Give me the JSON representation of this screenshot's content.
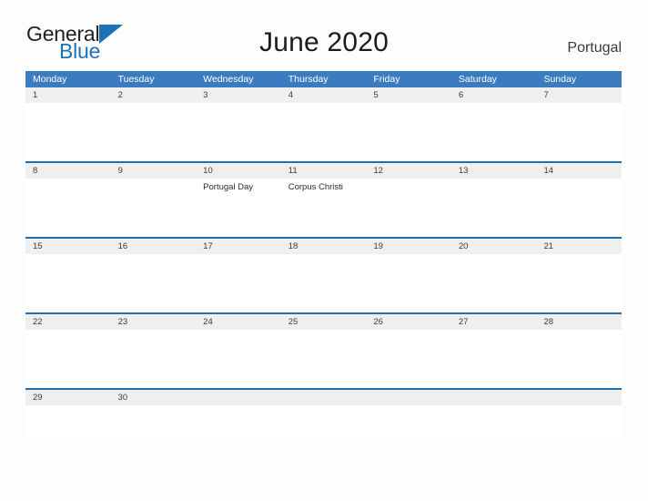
{
  "brand": {
    "name_part1": "General",
    "name_part2": "Blue",
    "mark": "triangle-icon",
    "accent_color": "#1c72b8"
  },
  "header": {
    "title": "June 2020",
    "country": "Portugal"
  },
  "colors": {
    "header_band": "#3b7cc0",
    "rule": "#1f6fb2",
    "date_stripe": "#efefef",
    "page_background": "#fdfdfd"
  },
  "weekdays": [
    "Monday",
    "Tuesday",
    "Wednesday",
    "Thursday",
    "Friday",
    "Saturday",
    "Sunday"
  ],
  "weeks": [
    {
      "dates": [
        "1",
        "2",
        "3",
        "4",
        "5",
        "6",
        "7"
      ],
      "events": [
        "",
        "",
        "",
        "",
        "",
        "",
        ""
      ]
    },
    {
      "dates": [
        "8",
        "9",
        "10",
        "11",
        "12",
        "13",
        "14"
      ],
      "events": [
        "",
        "",
        "Portugal Day",
        "Corpus Christi",
        "",
        "",
        ""
      ]
    },
    {
      "dates": [
        "15",
        "16",
        "17",
        "18",
        "19",
        "20",
        "21"
      ],
      "events": [
        "",
        "",
        "",
        "",
        "",
        "",
        ""
      ]
    },
    {
      "dates": [
        "22",
        "23",
        "24",
        "25",
        "26",
        "27",
        "28"
      ],
      "events": [
        "",
        "",
        "",
        "",
        "",
        "",
        ""
      ]
    },
    {
      "dates": [
        "29",
        "30",
        "",
        "",
        "",
        "",
        ""
      ],
      "events": [
        "",
        "",
        "",
        "",
        "",
        "",
        ""
      ]
    }
  ]
}
